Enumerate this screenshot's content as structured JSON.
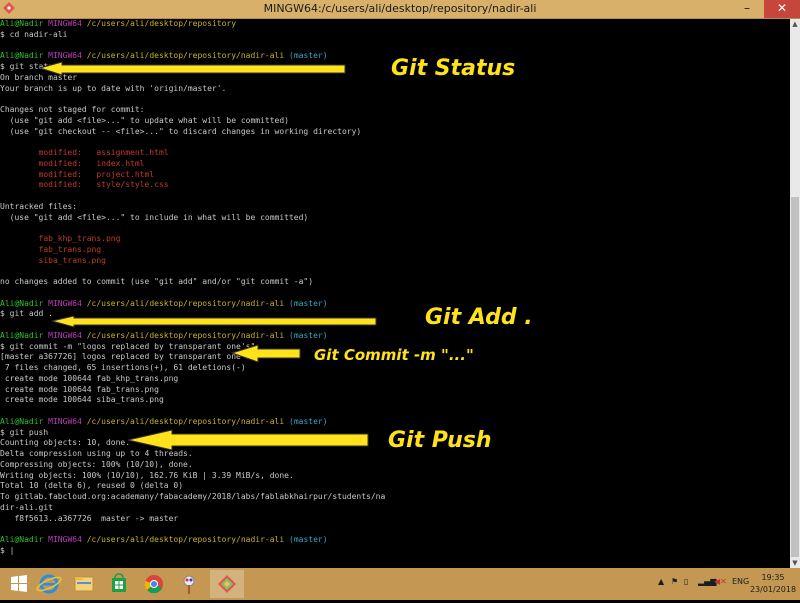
{
  "window": {
    "title": "MINGW64:/c/users/ali/desktop/repository/nadir-ali",
    "min_symbol": "–",
    "max_symbol": "❐",
    "close_symbol": "✕"
  },
  "terminal": {
    "lines": [
      {
        "segs": [
          {
            "t": "Ali@Nadir ",
            "c": "u"
          },
          {
            "t": "MINGW64 ",
            "c": "m"
          },
          {
            "t": "/c/users/ali/desktop/repository",
            "c": "p"
          }
        ]
      },
      {
        "segs": [
          {
            "t": "$ cd nadir-ali",
            "c": ""
          }
        ]
      },
      {
        "segs": [
          {
            "t": "",
            "c": ""
          }
        ]
      },
      {
        "segs": [
          {
            "t": "Ali@Nadir ",
            "c": "u"
          },
          {
            "t": "MINGW64 ",
            "c": "m"
          },
          {
            "t": "/c/users/ali/desktop/repository/nadir-ali ",
            "c": "p"
          },
          {
            "t": "(master)",
            "c": "b"
          }
        ]
      },
      {
        "segs": [
          {
            "t": "$ git status",
            "c": ""
          }
        ]
      },
      {
        "segs": [
          {
            "t": "On branch master",
            "c": ""
          }
        ]
      },
      {
        "segs": [
          {
            "t": "Your branch is up to date with 'origin/master'.",
            "c": ""
          }
        ]
      },
      {
        "segs": [
          {
            "t": "",
            "c": ""
          }
        ]
      },
      {
        "segs": [
          {
            "t": "Changes not staged for commit:",
            "c": ""
          }
        ]
      },
      {
        "segs": [
          {
            "t": "  (use \"git add <file>...\" to update what will be committed)",
            "c": ""
          }
        ]
      },
      {
        "segs": [
          {
            "t": "  (use \"git checkout -- <file>...\" to discard changes in working directory)",
            "c": ""
          }
        ]
      },
      {
        "segs": [
          {
            "t": "",
            "c": ""
          }
        ]
      },
      {
        "segs": [
          {
            "t": "        modified:   assignment.html",
            "c": "r"
          }
        ]
      },
      {
        "segs": [
          {
            "t": "        modified:   index.html",
            "c": "r"
          }
        ]
      },
      {
        "segs": [
          {
            "t": "        modified:   project.html",
            "c": "r"
          }
        ]
      },
      {
        "segs": [
          {
            "t": "        modified:   style/style.css",
            "c": "r"
          }
        ]
      },
      {
        "segs": [
          {
            "t": "",
            "c": ""
          }
        ]
      },
      {
        "segs": [
          {
            "t": "Untracked files:",
            "c": ""
          }
        ]
      },
      {
        "segs": [
          {
            "t": "  (use \"git add <file>...\" to include in what will be committed)",
            "c": ""
          }
        ]
      },
      {
        "segs": [
          {
            "t": "",
            "c": ""
          }
        ]
      },
      {
        "segs": [
          {
            "t": "        fab_khp_trans.png",
            "c": "r"
          }
        ]
      },
      {
        "segs": [
          {
            "t": "        fab_trans.png",
            "c": "r"
          }
        ]
      },
      {
        "segs": [
          {
            "t": "        siba_trans.png",
            "c": "r"
          }
        ]
      },
      {
        "segs": [
          {
            "t": "",
            "c": ""
          }
        ]
      },
      {
        "segs": [
          {
            "t": "no changes added to commit (use \"git add\" and/or \"git commit -a\")",
            "c": ""
          }
        ]
      },
      {
        "segs": [
          {
            "t": "",
            "c": ""
          }
        ]
      },
      {
        "segs": [
          {
            "t": "Ali@Nadir ",
            "c": "u"
          },
          {
            "t": "MINGW64 ",
            "c": "m"
          },
          {
            "t": "/c/users/ali/desktop/repository/nadir-ali ",
            "c": "p"
          },
          {
            "t": "(master)",
            "c": "b"
          }
        ]
      },
      {
        "segs": [
          {
            "t": "$ git add .",
            "c": ""
          }
        ]
      },
      {
        "segs": [
          {
            "t": "",
            "c": ""
          }
        ]
      },
      {
        "segs": [
          {
            "t": "Ali@Nadir ",
            "c": "u"
          },
          {
            "t": "MINGW64 ",
            "c": "m"
          },
          {
            "t": "/c/users/ali/desktop/repository/nadir-ali ",
            "c": "p"
          },
          {
            "t": "(master)",
            "c": "b"
          }
        ]
      },
      {
        "segs": [
          {
            "t": "$ git commit -m \"logos replaced by transparant one's\"",
            "c": ""
          }
        ]
      },
      {
        "segs": [
          {
            "t": "[master a367726] logos replaced by transparant one's",
            "c": ""
          }
        ]
      },
      {
        "segs": [
          {
            "t": " 7 files changed, 65 insertions(+), 61 deletions(-)",
            "c": ""
          }
        ]
      },
      {
        "segs": [
          {
            "t": " create mode 100644 fab_khp_trans.png",
            "c": ""
          }
        ]
      },
      {
        "segs": [
          {
            "t": " create mode 100644 fab_trans.png",
            "c": ""
          }
        ]
      },
      {
        "segs": [
          {
            "t": " create mode 100644 siba_trans.png",
            "c": ""
          }
        ]
      },
      {
        "segs": [
          {
            "t": "",
            "c": ""
          }
        ]
      },
      {
        "segs": [
          {
            "t": "Ali@Nadir ",
            "c": "u"
          },
          {
            "t": "MINGW64 ",
            "c": "m"
          },
          {
            "t": "/c/users/ali/desktop/repository/nadir-ali ",
            "c": "p"
          },
          {
            "t": "(master)",
            "c": "b"
          }
        ]
      },
      {
        "segs": [
          {
            "t": "$ git push",
            "c": ""
          }
        ]
      },
      {
        "segs": [
          {
            "t": "Counting objects: 10, done.",
            "c": ""
          }
        ]
      },
      {
        "segs": [
          {
            "t": "Delta compression using up to 4 threads.",
            "c": ""
          }
        ]
      },
      {
        "segs": [
          {
            "t": "Compressing objects: 100% (10/10), done.",
            "c": ""
          }
        ]
      },
      {
        "segs": [
          {
            "t": "Writing objects: 100% (10/10), 162.76 KiB | 3.39 MiB/s, done.",
            "c": ""
          }
        ]
      },
      {
        "segs": [
          {
            "t": "Total 10 (delta 6), reused 0 (delta 0)",
            "c": ""
          }
        ]
      },
      {
        "segs": [
          {
            "t": "To gitlab.fabcloud.org:academany/fabacademy/2018/labs/fablabkhairpur/students/na",
            "c": ""
          }
        ]
      },
      {
        "segs": [
          {
            "t": "dir-ali.git",
            "c": ""
          }
        ]
      },
      {
        "segs": [
          {
            "t": "   f8f5613..a367726  master -> master",
            "c": ""
          }
        ]
      },
      {
        "segs": [
          {
            "t": "",
            "c": ""
          }
        ]
      },
      {
        "segs": [
          {
            "t": "Ali@Nadir ",
            "c": "u"
          },
          {
            "t": "MINGW64 ",
            "c": "m"
          },
          {
            "t": "/c/users/ali/desktop/repository/nadir-ali ",
            "c": "p"
          },
          {
            "t": "(master)",
            "c": "b"
          }
        ]
      },
      {
        "segs": [
          {
            "t": "$ |",
            "c": ""
          }
        ]
      }
    ]
  },
  "annotations": {
    "status": "Git Status",
    "add": "Git Add .",
    "commit": "Git Commit -m \"...\"",
    "push": "Git Push"
  },
  "taskbar": {
    "apps": [
      {
        "name": "start",
        "icon": "windows-logo-icon"
      },
      {
        "name": "ie",
        "icon": "internet-explorer-icon"
      },
      {
        "name": "explorer",
        "icon": "file-explorer-icon"
      },
      {
        "name": "store",
        "icon": "store-icon"
      },
      {
        "name": "chrome",
        "icon": "chrome-icon"
      },
      {
        "name": "paint",
        "icon": "paint-tool-icon"
      },
      {
        "name": "gitbash",
        "icon": "git-bash-icon"
      }
    ],
    "lang": "ENG",
    "time": "19:35",
    "date": "23/01/2018"
  },
  "colors": {
    "user": "#2fbf2f",
    "mingw": "#b83bb8",
    "path": "#c8b12a",
    "branch": "#3aa6c2",
    "modified": "#c0392b",
    "annotation": "#ffe21a",
    "taskbar": "#c49853"
  }
}
